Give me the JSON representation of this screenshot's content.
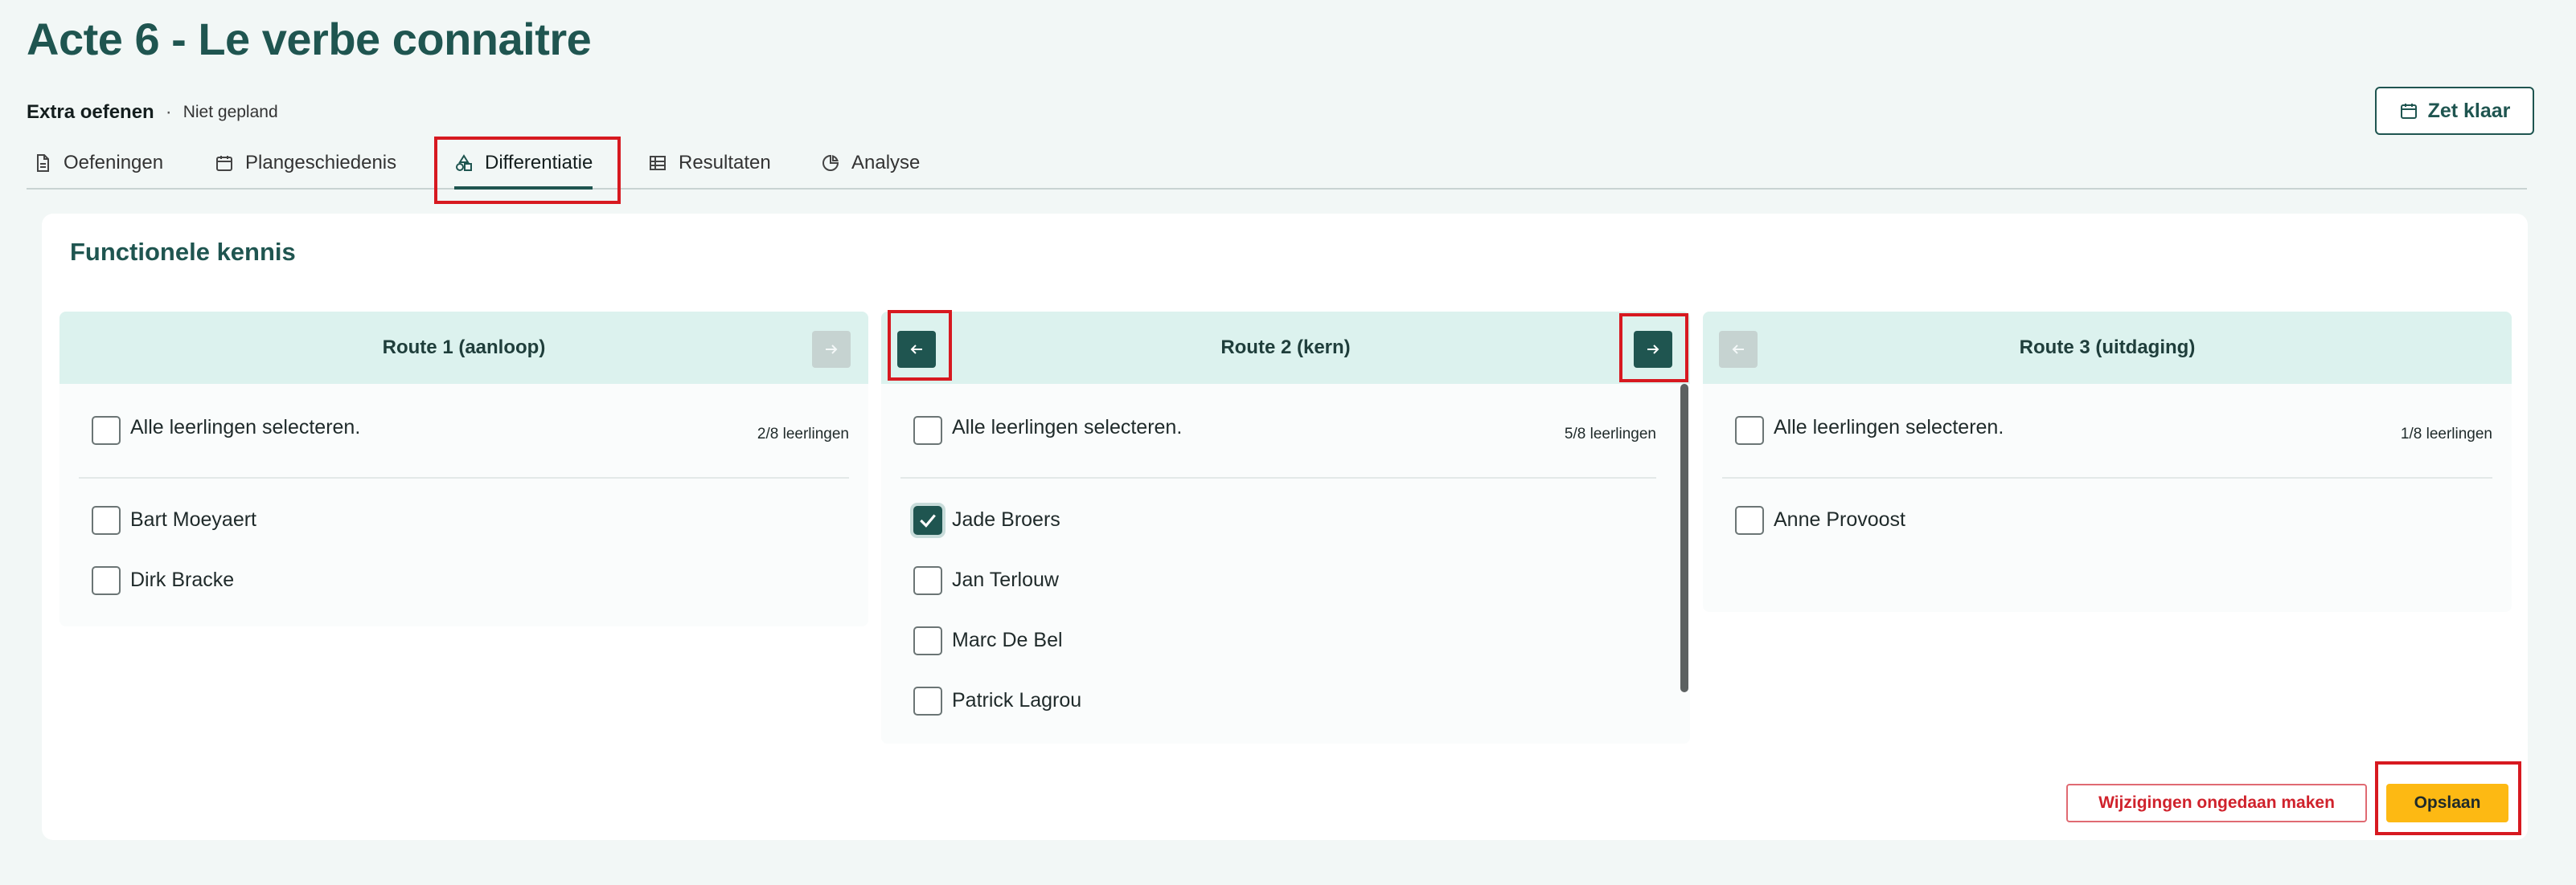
{
  "page": {
    "title": "Acte 6 - Le verbe connaitre",
    "category": "Extra oefenen",
    "separator": "·",
    "status": "Niet gepland",
    "action_button": "Zet klaar"
  },
  "tabs": [
    {
      "label": "Oefeningen",
      "icon": "document-icon"
    },
    {
      "label": "Plangeschiedenis",
      "icon": "calendar-icon"
    },
    {
      "label": "Differentiatie",
      "icon": "shapes-icon",
      "active": true
    },
    {
      "label": "Resultaten",
      "icon": "table-icon"
    },
    {
      "label": "Analyse",
      "icon": "pie-chart-icon"
    }
  ],
  "section": {
    "title": "Functionele kennis"
  },
  "routes": [
    {
      "title": "Route 1 (aanloop)",
      "select_all": "Alle leerlingen selecteren.",
      "count": "2/8 leerlingen",
      "students": [
        "Bart Moeyaert",
        "Dirk Bracke"
      ]
    },
    {
      "title": "Route 2 (kern)",
      "select_all": "Alle leerlingen selecteren.",
      "count": "5/8 leerlingen",
      "students": [
        "Jade Broers",
        "Jan Terlouw",
        "Marc De Bel",
        "Patrick Lagrou"
      ],
      "checked": [
        "Jade Broers"
      ]
    },
    {
      "title": "Route 3 (uitdaging)",
      "select_all": "Alle leerlingen selecteren.",
      "count": "1/8 leerlingen",
      "students": [
        "Anne Provoost"
      ]
    }
  ],
  "footer": {
    "undo_label": "Wijzigingen ongedaan maken",
    "save_label": "Opslaan"
  },
  "colors": {
    "primary": "#1f5550",
    "header_bg": "#dcf2ee",
    "save": "#fdb913",
    "danger": "#d0222c",
    "highlight": "#d71920"
  }
}
